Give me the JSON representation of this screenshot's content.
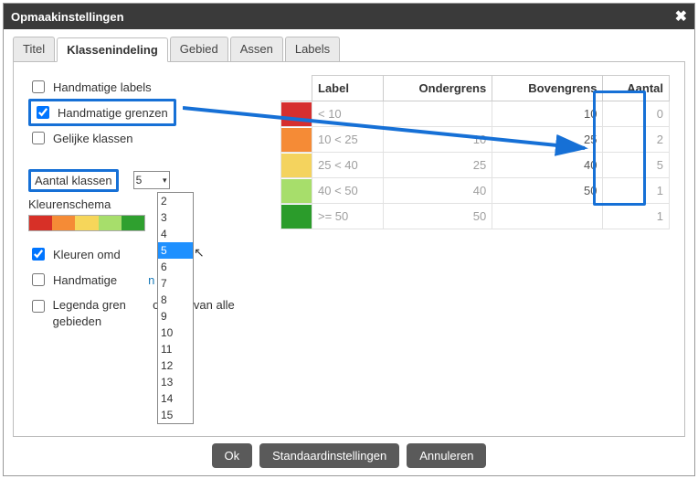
{
  "dialog": {
    "title": "Opmaakinstellingen"
  },
  "tabs": [
    "Titel",
    "Klassenindeling",
    "Gebied",
    "Assen",
    "Labels"
  ],
  "activeTab": 1,
  "options": {
    "handmatige_labels": "Handmatige labels",
    "handmatige_grenzen": "Handmatige grenzen",
    "gelijke_klassen": "Gelijke klassen",
    "aantal_klassen": "Aantal klassen",
    "aantal_value": "5",
    "kleurenschema": "Kleurenschema",
    "kleuren_omd": "Kleuren omd",
    "handmatige_k": "Handmatige",
    "handmatige_suffix": "n",
    "legenda": "Legenda gren",
    "legenda_suffix": "o basis van alle gebieden"
  },
  "dropdown": [
    "2",
    "3",
    "4",
    "5",
    "6",
    "7",
    "8",
    "9",
    "10",
    "11",
    "12",
    "13",
    "14",
    "15"
  ],
  "dropdown_selected": "5",
  "swatches": [
    "#d73027",
    "#f58b36",
    "#f6d65a",
    "#a7de6b",
    "#2fa02f"
  ],
  "table": {
    "headers": [
      "Label",
      "Ondergrens",
      "Bovengrens",
      "Aantal"
    ],
    "rows": [
      {
        "color": "#d62f2f",
        "label": "< 10",
        "onder": "",
        "boven": "10",
        "aantal": "0"
      },
      {
        "color": "#f58b36",
        "label": "10 < 25",
        "onder": "10",
        "boven": "25",
        "aantal": "2"
      },
      {
        "color": "#f4d35e",
        "label": "25 < 40",
        "onder": "25",
        "boven": "40",
        "aantal": "5"
      },
      {
        "color": "#a7de6b",
        "label": "40 < 50",
        "onder": "40",
        "boven": "50",
        "aantal": "1"
      },
      {
        "color": "#2b9c2b",
        "label": ">= 50",
        "onder": "50",
        "boven": "",
        "aantal": "1"
      }
    ]
  },
  "buttons": {
    "ok": "Ok",
    "defaults": "Standaardinstellingen",
    "cancel": "Annuleren"
  }
}
